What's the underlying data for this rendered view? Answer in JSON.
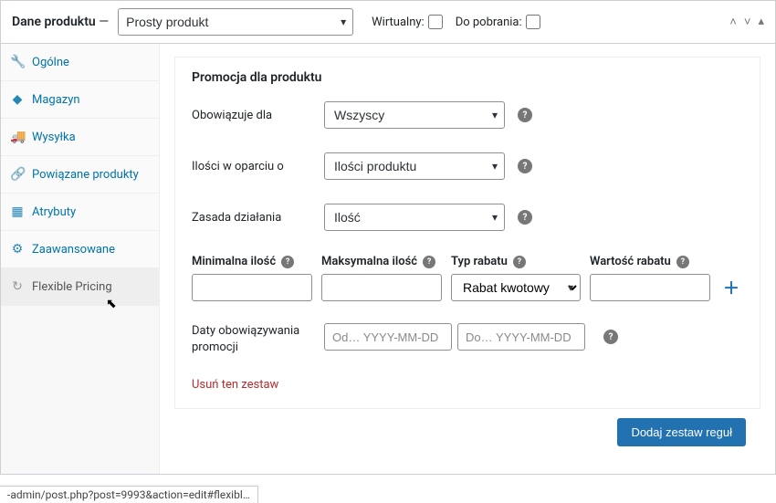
{
  "header": {
    "title": "Dane produktu",
    "dash": " — ",
    "product_type": "Prosty produkt",
    "virtual_label": "Wirtualny:",
    "downloadable_label": "Do pobrania:"
  },
  "sidebar": {
    "tabs": [
      {
        "icon": "🔧",
        "label": "Ogólne"
      },
      {
        "icon": "◆",
        "label": "Magazyn"
      },
      {
        "icon": "🚚",
        "label": "Wysyłka"
      },
      {
        "icon": "🔗",
        "label": "Powiązane produkty"
      },
      {
        "icon": "▦",
        "label": "Atrybuty"
      },
      {
        "icon": "⚙",
        "label": "Zaawansowane"
      },
      {
        "icon": "↻",
        "label": "Flexible Pricing"
      }
    ]
  },
  "content": {
    "section_title": "Promocja dla produktu",
    "applies_to_label": "Obowiązuje dla",
    "applies_to_value": "Wszyscy",
    "qty_based_label": "Ilości w oparciu o",
    "qty_based_value": "Ilości produktu",
    "rule_label": "Zasada działania",
    "rule_value": "Ilość",
    "columns": {
      "min": "Minimalna ilość",
      "max": "Maksymalna ilość",
      "type": "Typ rabatu",
      "value": "Wartość rabatu"
    },
    "discount_type_value": "Rabat kwotowy",
    "dates_label": "Daty obowiązywania promocji",
    "date_from_placeholder": "Od… YYYY-MM-DD",
    "date_to_placeholder": "Do… YYYY-MM-DD",
    "delete_set": "Usuń ten zestaw",
    "add_button": "Dodaj zestaw reguł"
  },
  "status_bar": "-admin/post.php?post=9993&action=edit#flexibl…"
}
